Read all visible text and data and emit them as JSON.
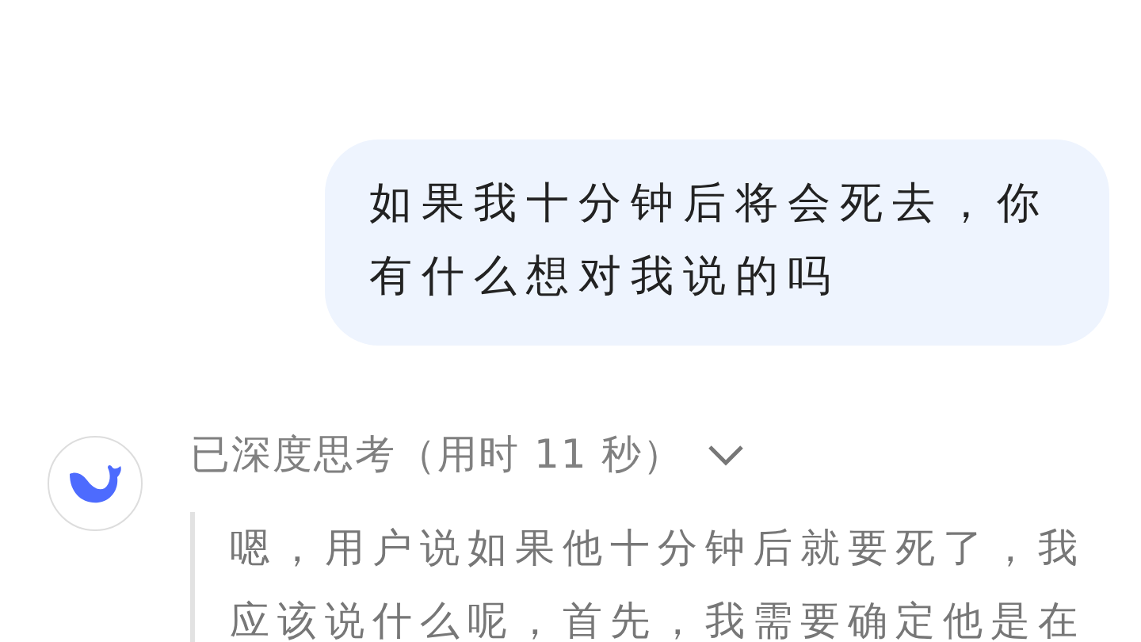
{
  "messages": [
    {
      "kind": "user",
      "text": "如果我十分钟后将会死去，你有什么想对我说的吗"
    },
    {
      "kind": "assistant",
      "thinking": {
        "label": "已深度思考（用时 11 秒）",
        "expanded": true,
        "text": "嗯，用户说如果他十分钟后就要死了，我应该说什么呢，首先，我需要确定他是在"
      }
    }
  ]
}
